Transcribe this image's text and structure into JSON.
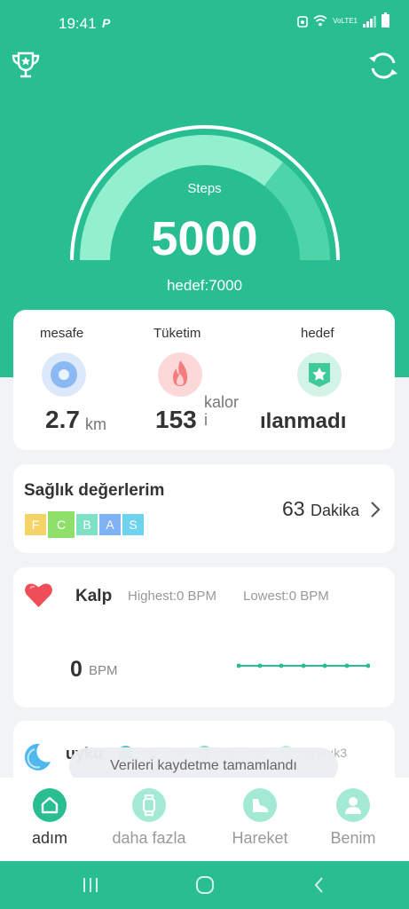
{
  "status_bar": {
    "time": "19:41",
    "p_badge": "P",
    "network": "VoLTE1",
    "colors": {
      "bg": "#28be91"
    }
  },
  "header": {
    "left_icon": "trophy-icon",
    "right_icon": "sync-icon"
  },
  "gauge": {
    "label": "Steps",
    "value": "5000",
    "goal_label": "hedef:7000",
    "progress": 0.714,
    "colors": {
      "filled": "#93f0cf",
      "track": "#4dd5a9",
      "ring": "#ffffff"
    }
  },
  "stats": {
    "distance": {
      "title": "mesafe",
      "value": "2.7",
      "unit": "km",
      "icon": "location-icon"
    },
    "consumption": {
      "title": "Tüketim",
      "value": "153",
      "unit_line1": "kalor",
      "unit_line2": "i",
      "icon": "flame-icon"
    },
    "target": {
      "title": "hedef",
      "value": "ılanmadı",
      "icon": "star-badge-icon"
    }
  },
  "health": {
    "title": "Sağlık değerlerim",
    "grades": [
      {
        "letter": "F",
        "color": "#f5d467"
      },
      {
        "letter": "C",
        "color": "#8fe06a"
      },
      {
        "letter": "B",
        "color": "#7fe0c8"
      },
      {
        "letter": "A",
        "color": "#7fb1f5"
      },
      {
        "letter": "S",
        "color": "#6ed3ef"
      }
    ],
    "selected_grade": "C",
    "minutes": "63",
    "minutes_unit": "Dakika"
  },
  "heart": {
    "title": "Kalp",
    "highest": "Highest:0",
    "highest_unit": "BPM",
    "lowest": "Lowest:0",
    "lowest_unit": "BPM",
    "bpm": "0",
    "bpm_unit": "BPM"
  },
  "sleep": {
    "title": "uyku",
    "pct1": "%",
    "label2": "de",
    "pct2": "%",
    "label3": "ha",
    "label4": "uyanık3"
  },
  "toast": {
    "message": "Verileri kaydetme tamamlandı"
  },
  "bottom_nav": {
    "items": [
      {
        "label": "adım",
        "icon": "home-icon",
        "active": true
      },
      {
        "label": "daha fazla",
        "icon": "watch-icon",
        "active": false
      },
      {
        "label": "Hareket",
        "icon": "shoe-icon",
        "active": false
      },
      {
        "label": "Benim",
        "icon": "user-icon",
        "active": false
      }
    ],
    "colors": {
      "active": "#28be91",
      "inactive": "#a3e9d3"
    }
  }
}
